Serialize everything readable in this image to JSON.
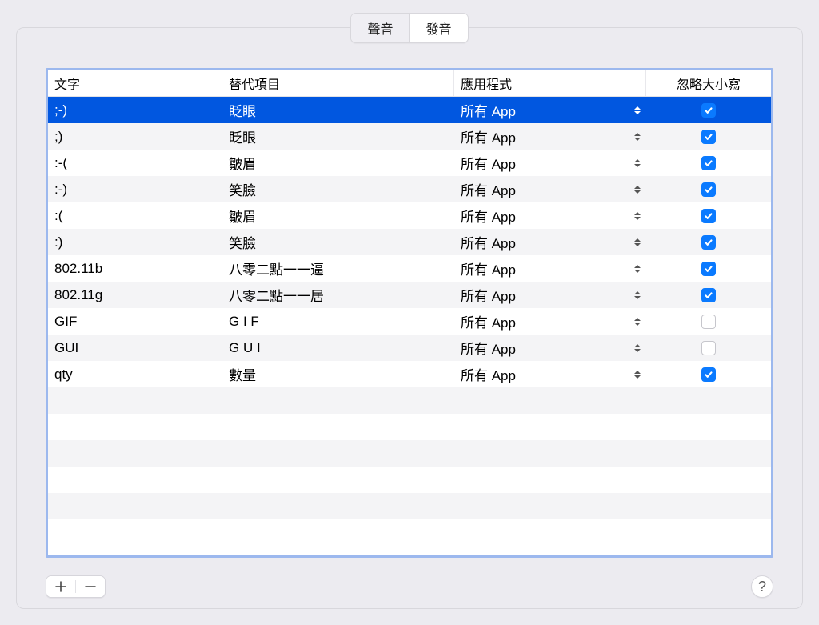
{
  "tabs": {
    "sound": "聲音",
    "pron": "發音",
    "active": "pron"
  },
  "columns": {
    "text": "文字",
    "replacement": "替代項目",
    "app": "應用程式",
    "ignoreCase": "忽略大小寫"
  },
  "rows": [
    {
      "text": ";-)",
      "replacement": "眨眼",
      "app": "所有 App",
      "ignoreCase": true,
      "selected": true
    },
    {
      "text": ";)",
      "replacement": "眨眼",
      "app": "所有 App",
      "ignoreCase": true,
      "selected": false
    },
    {
      "text": ":-(",
      "replacement": "皺眉",
      "app": "所有 App",
      "ignoreCase": true,
      "selected": false
    },
    {
      "text": ":-)",
      "replacement": "笑臉",
      "app": "所有 App",
      "ignoreCase": true,
      "selected": false
    },
    {
      "text": ":(",
      "replacement": "皺眉",
      "app": "所有 App",
      "ignoreCase": true,
      "selected": false
    },
    {
      "text": ":)",
      "replacement": "笑臉",
      "app": "所有 App",
      "ignoreCase": true,
      "selected": false
    },
    {
      "text": "802.11b",
      "replacement": "八零二點一一逼",
      "app": "所有 App",
      "ignoreCase": true,
      "selected": false
    },
    {
      "text": "802.11g",
      "replacement": "八零二點一一居",
      "app": "所有 App",
      "ignoreCase": true,
      "selected": false
    },
    {
      "text": "GIF",
      "replacement": "G I F",
      "app": "所有 App",
      "ignoreCase": false,
      "selected": false
    },
    {
      "text": "GUI",
      "replacement": "G U I",
      "app": "所有 App",
      "ignoreCase": false,
      "selected": false
    },
    {
      "text": "qty",
      "replacement": "數量",
      "app": "所有 App",
      "ignoreCase": true,
      "selected": false
    }
  ],
  "emptyRows": 5,
  "buttons": {
    "add": "＋",
    "remove": "－",
    "help": "?"
  }
}
